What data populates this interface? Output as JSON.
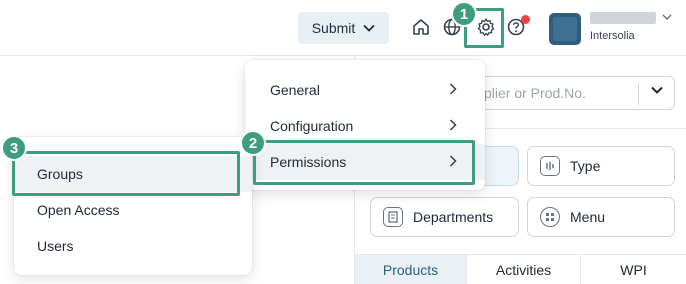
{
  "header": {
    "submit_label": "Submit",
    "user_org": "Intersolia",
    "icons": [
      "home-icon",
      "globe-icon",
      "gear-icon",
      "help-icon"
    ],
    "notification_color": "#ef4444"
  },
  "search": {
    "placeholder_fragment": "plier or Prod.No."
  },
  "tiles": [
    {
      "label": "Type",
      "icon": "type-icon"
    },
    {
      "label": "Departments",
      "icon": "departments-icon"
    },
    {
      "label": "Menu",
      "icon": "menu-icon"
    }
  ],
  "tabs": [
    {
      "label": "Products",
      "active": true
    },
    {
      "label": "Activities",
      "active": false
    },
    {
      "label": "WPI",
      "active": false
    }
  ],
  "settings_menu": {
    "items": [
      {
        "label": "General"
      },
      {
        "label": "Configuration"
      },
      {
        "label": "Permissions",
        "hovered": true
      }
    ]
  },
  "permissions_submenu": {
    "items": [
      {
        "label": "Groups",
        "hovered": true
      },
      {
        "label": "Open Access"
      },
      {
        "label": "Users"
      }
    ]
  },
  "annotations": {
    "step1": "1",
    "step2": "2",
    "step3": "3",
    "color": "#3e9d7f"
  }
}
